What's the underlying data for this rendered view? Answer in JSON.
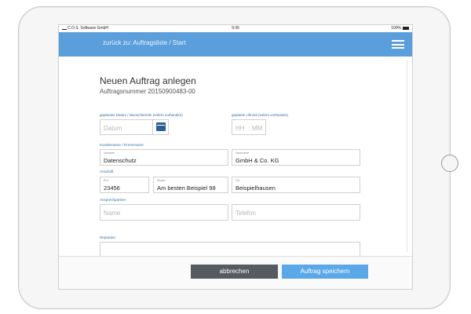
{
  "statusbar": {
    "carrier": "C.O.S. Software GmbH",
    "time": "9:36",
    "battery": "100%"
  },
  "navbar": {
    "back_link": "zurück zu: Auftragsliste / Start"
  },
  "form": {
    "title": "Neuen Auftrag anlegen",
    "order_number": "Auftragsnummer 20150900483-00",
    "date": {
      "label": "geplantes Datum / Wunschtermin (sofern vorhanden)",
      "placeholder": "Datum"
    },
    "time": {
      "label": "geplante Uhrzeit (sofern vorhanden)",
      "hh_placeholder": "HH",
      "separator": ":",
      "mm_placeholder": "MM"
    },
    "customer": {
      "label": "Kundenname / Firmenname",
      "first_sub": "Vorname",
      "first_value": "Datenschutz",
      "last_sub": "Nachname",
      "last_value": "GmbH & Co. KG"
    },
    "address": {
      "label": "Anschrift",
      "zip_sub": "PLZ",
      "zip_value": "23456",
      "street_sub": "Straße",
      "street_value": "Am besten Beispiel 98",
      "city_sub": "Ort",
      "city_value": "Beispielhausen"
    },
    "contact": {
      "label": "Ansprechpartner",
      "name_placeholder": "Name",
      "phone_placeholder": "Telefon"
    },
    "repair": {
      "label": "Reparatur"
    }
  },
  "footer": {
    "cancel_label": "abbrechen",
    "save_label": "Auftrag speichern"
  },
  "colors": {
    "navbar": "#5a9edc",
    "cancel_button": "#555b61",
    "save_button": "#5aa8e8",
    "label_accent": "#2f6fb0"
  }
}
